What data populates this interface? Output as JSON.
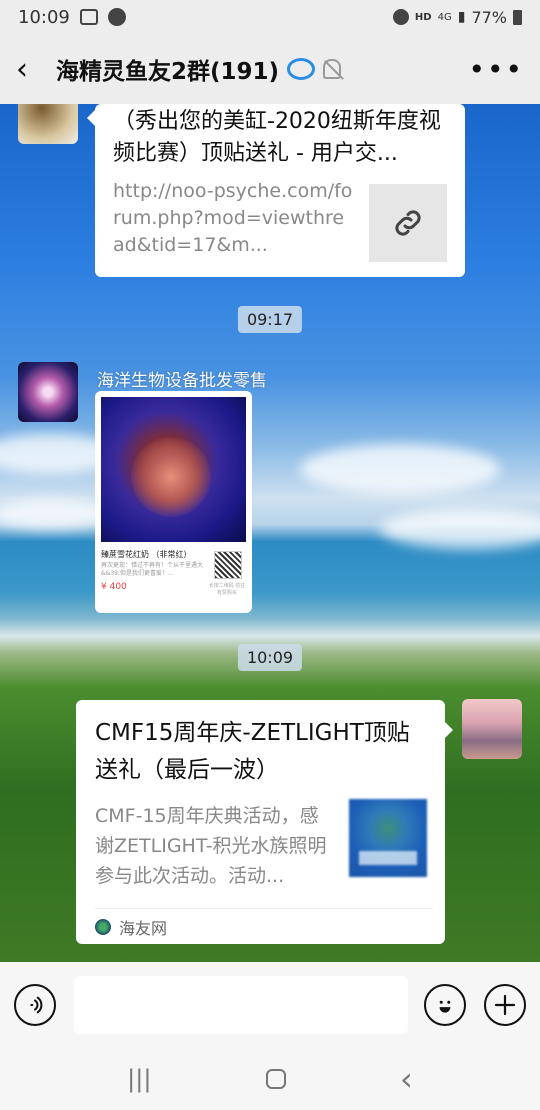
{
  "status": {
    "time": "10:09",
    "network": "HD",
    "signal": "4G",
    "battery": "77%"
  },
  "header": {
    "back_icon": "back-arrow-icon",
    "title": "海精灵鱼友2群(191)",
    "more_icon": "more-icon"
  },
  "messages": {
    "link_card": {
      "title": "（秀出您的美缸-2020纽斯年度视频比赛）顶贴送礼 - 用户交...",
      "url": "http://noo-psyche.com/forum.php?mod=viewthread&tid=17&m..."
    },
    "time_1": "09:17",
    "sender_name": "海洋生物设备批发零售",
    "product_card": {
      "name": "臻蔗雪花红奶 （非常红）",
      "desc": "再次更现：错过不再有！个从干里遇大&&39;但是我们更喜爱！...",
      "price": "¥ 400",
      "qr_text": "长按二维码 前往有赞购买"
    },
    "time_2": "10:09",
    "news_card": {
      "title": "CMF15周年庆-ZETLIGHT顶贴送礼（最后一波）",
      "desc": "CMF-15周年庆典活动，感谢ZETLIGHT-积光水族照明参与此次活动。活动...",
      "source": "海友网"
    }
  },
  "input": {
    "voice_icon": "voice-icon",
    "emoji_icon": "emoji-icon",
    "plus_icon": "plus-icon"
  },
  "navbar": {
    "recent": "|||",
    "back": "‹"
  }
}
